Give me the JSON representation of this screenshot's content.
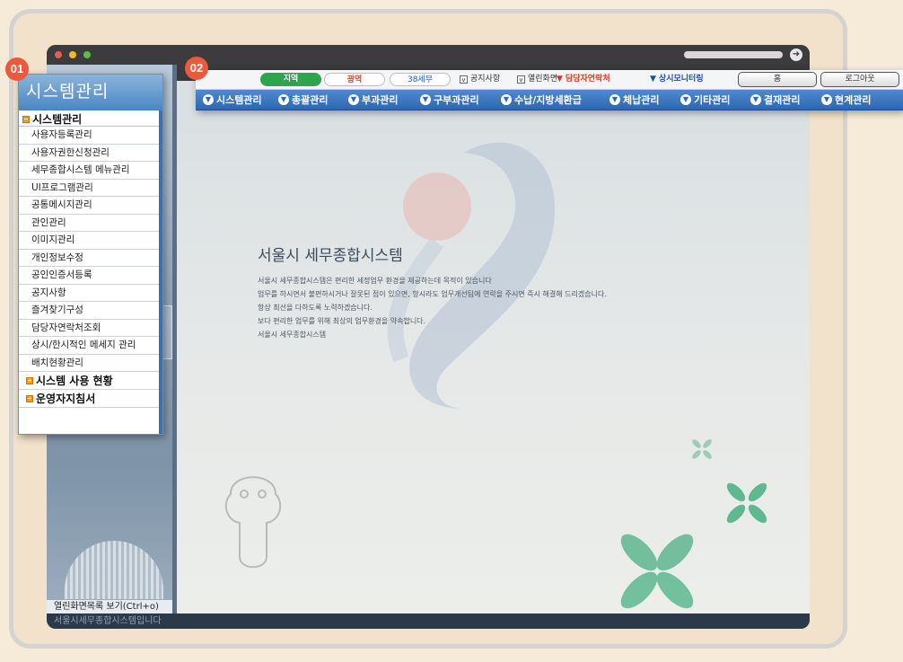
{
  "badges": {
    "sidebar": "01",
    "topbar": "02"
  },
  "sidebar_menu": {
    "title": "시스템관리",
    "open_group": "시스템관리",
    "items": [
      "사용자등록관리",
      "사용자권한신청관리",
      "세무종합시스템 메뉴관리",
      "UI프로그램관리",
      "공통메시지관리",
      "관인관리",
      "이미지관리",
      "개인정보수정",
      "공인인증서등록",
      "공지사항",
      "즐겨찾기구성",
      "담당자연락처조회",
      "상시/한시적인 메세지 관리",
      "배치현황관리"
    ],
    "groups": [
      "시스템 사용 현황",
      "운영자지침서"
    ]
  },
  "topbar": {
    "tabs": [
      "지역",
      "광역",
      "38세무"
    ],
    "notice_label": "공지사항",
    "open_screen_label": "열린화면",
    "contact_label": "담당자연락처",
    "monitor_label": "상시모니터링",
    "home_label": "홈",
    "logout_label": "로그아웃"
  },
  "nav": [
    "시스템관리",
    "총괄관리",
    "부과관리",
    "구부과관리",
    "수납/지방세환급",
    "체납관리",
    "기타관리",
    "결재관리",
    "현계관리"
  ],
  "content": {
    "title": "서울시 세무종합시스템",
    "lines": [
      "서울시 세무종합시스템은 편리한 세정업무 환경을 제공하는데 목적이 있습니다",
      "업무를 하시면서 불편하시거나 잘못된 점이 있으면, 항시라도 업무개선팀에 연락을 주시면 즉시 해결해 드리겠습니다.",
      "항상 최선을 다하도록 노력하겠습니다.",
      "보다 편리한 업무를 위해 최상의 업무환경을 약속합니다.",
      "서울시 세무종합시스템"
    ]
  },
  "footer": {
    "open_list_label": "열린화면목록 보기(Ctrl+o)",
    "status_text": "서울시세무종합시스템입니다"
  },
  "colors": {
    "accent_blue": "#2c67b0",
    "badge": "#ea5a3d",
    "region_tab": "#2ea44f"
  }
}
